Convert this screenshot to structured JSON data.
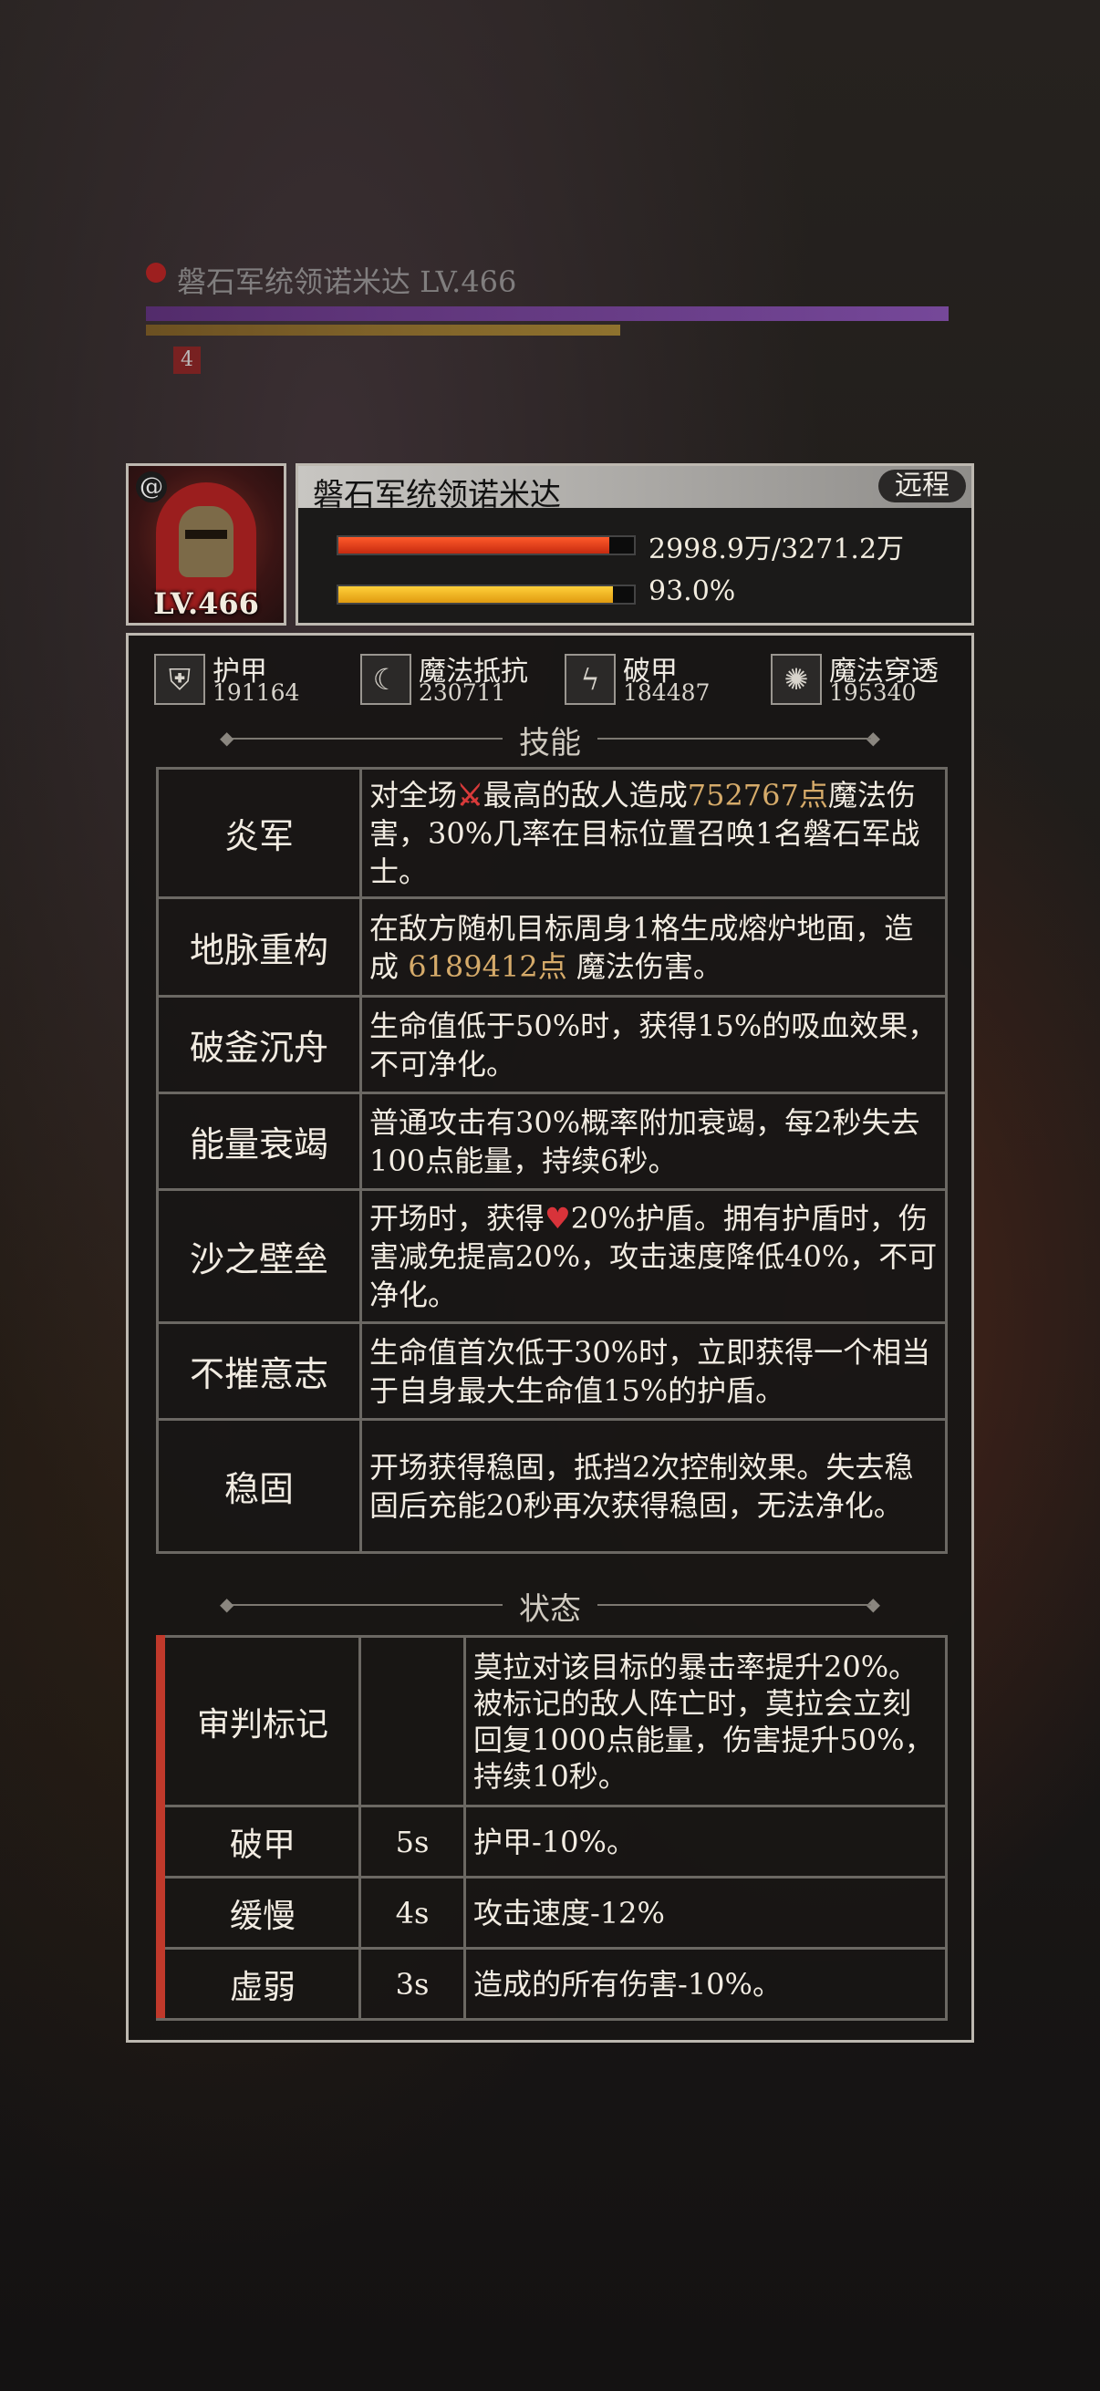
{
  "background": {
    "boss_label": "磐石军统领诺米达 LV.466",
    "tag": "4"
  },
  "header": {
    "level": "LV.466",
    "name": "磐石军统领诺米达",
    "range": "远程",
    "hp": {
      "text": "2998.9万/3271.2万",
      "fraction": 0.917
    },
    "energy": {
      "text": "93.0%",
      "fraction": 0.93
    }
  },
  "stats": [
    {
      "label": "护甲",
      "value": "191164",
      "icon": "armor-shield-icon"
    },
    {
      "label": "魔法抵抗",
      "value": "230711",
      "icon": "magic-resist-icon"
    },
    {
      "label": "破甲",
      "value": "184487",
      "icon": "armor-break-icon"
    },
    {
      "label": "魔法穿透",
      "value": "195340",
      "icon": "magic-penetration-icon"
    }
  ],
  "skills_title": "技能",
  "skills": [
    {
      "name": "炎军",
      "d1": "对全场",
      "d2": "最高的敌人造成",
      "hl": "752767点",
      "d3": "魔法伤害，30%几率在目标位置召唤1名磐石军战士。"
    },
    {
      "name": "地脉重构",
      "d1": "在敌方随机目标周身1格生成熔炉地面，造成 ",
      "hl": "6189412点",
      "d3": " 魔法伤害。"
    },
    {
      "name": "破釜沉舟",
      "desc": "生命值低于50%时，获得15%的吸血效果，不可净化。"
    },
    {
      "name": "能量衰竭",
      "desc": "普通攻击有30%概率附加衰竭，每2秒失去100点能量，持续6秒。"
    },
    {
      "name": "沙之壁垒",
      "d1": "开场时，获得",
      "d3": "20%护盾。拥有护盾时，伤害减免提高20%，攻击速度降低40%，不可净化。"
    },
    {
      "name": "不摧意志",
      "desc": "生命值首次低于30%时，立即获得一个相当于自身最大生命值15%的护盾。"
    },
    {
      "name": "稳固",
      "desc": "开场获得稳固，抵挡2次控制效果。失去稳固后充能20秒再次获得稳固，无法净化。"
    }
  ],
  "status_title": "状态",
  "statuses": [
    {
      "name": "审判标记",
      "duration": "",
      "desc": "莫拉对该目标的暴击率提升20%。被标记的敌人阵亡时，莫拉会立刻回复1000点能量，伤害提升50%，持续10秒。"
    },
    {
      "name": "破甲",
      "duration": "5s",
      "desc": "护甲-10%。"
    },
    {
      "name": "缓慢",
      "duration": "4s",
      "desc": "攻击速度-12%"
    },
    {
      "name": "虚弱",
      "duration": "3s",
      "desc": "造成的所有伤害-10%。"
    }
  ],
  "colors": {
    "accent_red": "#c0392b",
    "highlight": "#d6ab6a"
  }
}
